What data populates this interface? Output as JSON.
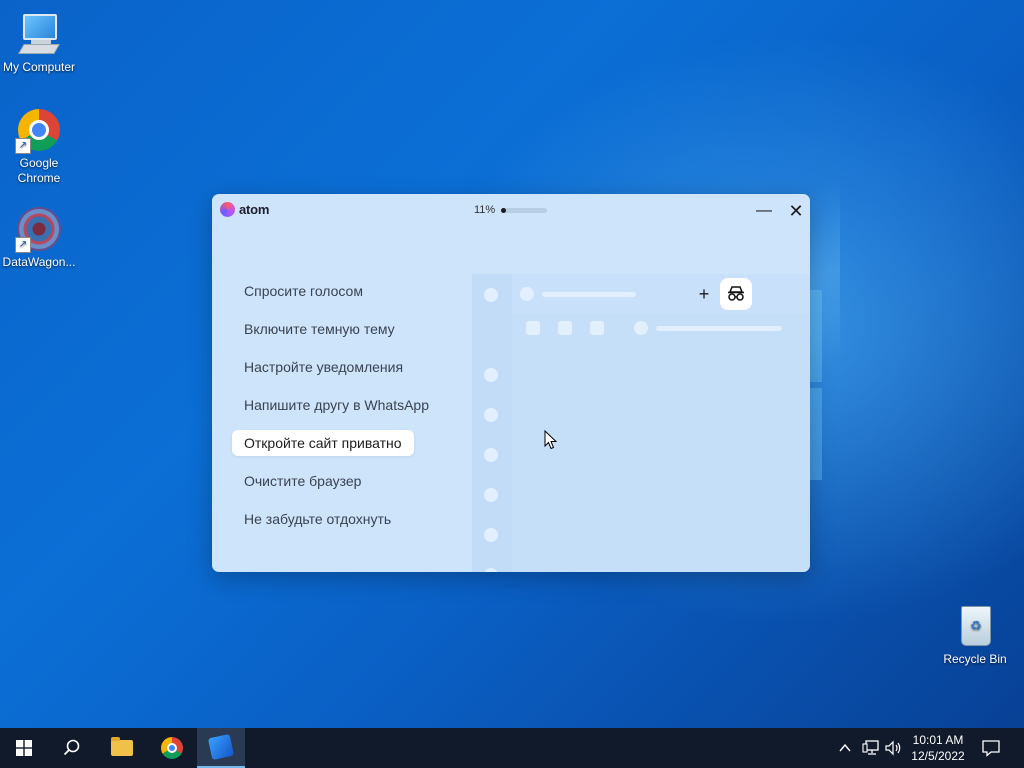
{
  "desktop": {
    "icons": [
      {
        "label": "My Computer",
        "icon": "computer-icon"
      },
      {
        "label": "Google\nChrome",
        "icon": "chrome-icon"
      },
      {
        "label": "DataWagon...",
        "icon": "datawagon-icon"
      },
      {
        "label": "Recycle Bin",
        "icon": "recycle-bin-icon"
      }
    ]
  },
  "atom": {
    "logo_text": "atom",
    "progress_label": "11%",
    "progress_value": 0.11,
    "minimize": "—",
    "close": "✕",
    "tips": [
      "Спросите голосом",
      "Включите темную тему",
      "Настройте уведомления",
      "Напишите другу в WhatsApp",
      "Откройте сайт приватно",
      "Очистите браузер",
      "Не забудьте отдохнуть"
    ],
    "active_tip_index": 4,
    "plus": "+",
    "colors": {
      "window_bg": "#cde4fb",
      "accent": "#1c1c1c"
    }
  },
  "taskbar": {
    "items": [
      "start-icon",
      "search-icon",
      "file-explorer-icon",
      "chrome-icon",
      "atom-browser-icon"
    ],
    "clock_time": "10:01 AM",
    "clock_date": "12/5/2022"
  }
}
